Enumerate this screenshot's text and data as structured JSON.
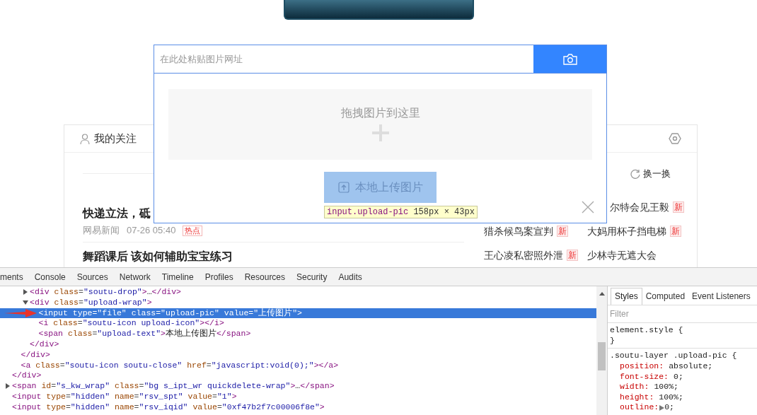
{
  "search_popup": {
    "url_field": {
      "placeholder": "在此处粘贴图片网址"
    },
    "drop_zone": {
      "text": "拖拽图片到这里"
    },
    "upload_button": {
      "label": "本地上传图片"
    }
  },
  "inspect_tooltip": {
    "selector": "input.upload-pic",
    "dimensions": "158px × 43px"
  },
  "feed": {
    "tab": {
      "label": "我的关注"
    },
    "articles": [
      {
        "title": "快递立法，砥",
        "source": "网易新闻",
        "time": "07-26 05:40",
        "tag": "热点"
      },
      {
        "title": "舞蹈课后 该如何辅助宝宝练习"
      }
    ]
  },
  "hot_list": {
    "refresh": "换一换",
    "rows": [
      {
        "right": {
          "text": "尔特会见王毅",
          "badge": "新"
        }
      },
      {
        "left": {
          "text": "猎杀候鸟案宣判",
          "badge": "新"
        },
        "right": {
          "text": "大妈用杯子挡电梯",
          "badge": "新"
        }
      },
      {
        "left": {
          "text": "王心凌私密照外泄",
          "badge": "新"
        },
        "right": {
          "text": "少林寺无遮大会"
        }
      }
    ]
  },
  "devtools": {
    "tabs": [
      {
        "label": "ments"
      },
      {
        "label": "Console"
      },
      {
        "label": "Sources"
      },
      {
        "label": "Network"
      },
      {
        "label": "Timeline"
      },
      {
        "label": "Profiles"
      },
      {
        "label": "Resources"
      },
      {
        "label": "Security"
      },
      {
        "label": "Audits"
      }
    ],
    "dom_tree": [
      {
        "selected": false,
        "close": "</div>",
        "children": [
          {
            "selected": false,
            "close": "</div>",
            "children": [
              {
                "text": "<div class=\"soutu-drop\">…</div>",
                "expanded": false,
                "selected": false
              },
              {
                "text": "<div class=\"upload-wrap\">",
                "expanded": true,
                "selected": false,
                "close": "</div>",
                "children": [
                  {
                    "text": "<input type=\"file\" class=\"upload-pic\" value=\"上传图片\">",
                    "selected": true
                  },
                  {
                    "text": "<i class=\"soutu-icon upload-icon\"></i>",
                    "selected": false
                  },
                  {
                    "text": "<span class=\"upload-text\">本地上传图片</span>",
                    "selected": false
                  }
                ]
              }
            ]
          },
          {
            "text": "<a class=\"soutu-icon soutu-close\" href=\"javascript:void(0);\"></a>",
            "selected": false
          }
        ]
      },
      {
        "text": "<span id=\"s_kw_wrap\" class=\"bg s_ipt_wr quickdelete-wrap\">…</span>",
        "expanded": false,
        "selected": false
      },
      {
        "text": "<input type=\"hidden\" name=\"rsv_spt\" value=\"1\">",
        "selected": false
      },
      {
        "text": "<input type=\"hidden\" name=\"rsv_iqid\" value=\"0xf47b2f7c00006f8e\">",
        "selected": false
      }
    ],
    "style_tabs": [
      {
        "label": "Styles",
        "selected": true
      },
      {
        "label": "Computed",
        "selected": false
      },
      {
        "label": "Event Listeners",
        "selected": false
      }
    ],
    "filter": {
      "placeholder": "Filter"
    },
    "rules": [
      {
        "header": "element.style {",
        "footer": "}"
      },
      {
        "header": ".soutu-layer .upload-pic {",
        "props": [
          {
            "name": "position:",
            "value": "absolute;"
          },
          {
            "name": "font-size:",
            "value": "0;"
          },
          {
            "name": "width:",
            "value": "100%;"
          },
          {
            "name": "height:",
            "value": "100%;"
          },
          {
            "name": "outline:",
            "value": "0;",
            "expandable": true
          }
        ]
      }
    ]
  }
}
